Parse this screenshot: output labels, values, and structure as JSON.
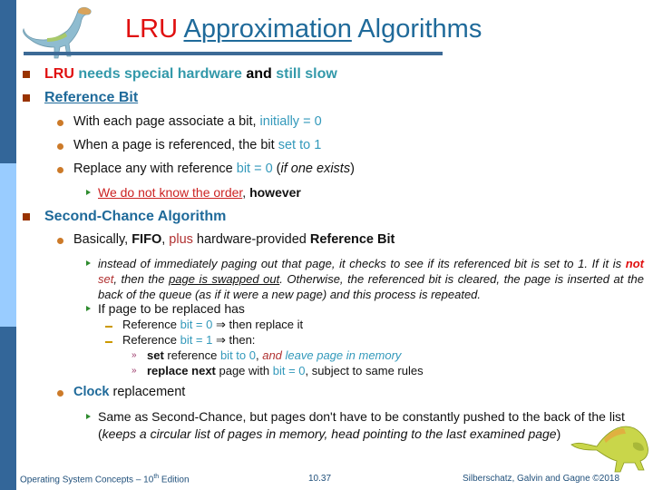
{
  "slide": {
    "title": {
      "part1": "LRU",
      "part2": "Approximation",
      "part3": "Algorithms"
    },
    "bullets": {
      "b1": {
        "lru": "LRU",
        "a": "needs special hardware",
        "and": "and",
        "b": "still slow"
      },
      "b2": {
        "label": "Reference Bit"
      },
      "b2_1": {
        "a": "With each page associate a bit, ",
        "b": "initially = 0"
      },
      "b2_2": {
        "a": "When a page is referenced, the bit ",
        "b": "set to 1"
      },
      "b2_3": {
        "a": "Replace any with reference ",
        "b": "bit = 0",
        "c": " (",
        "d": "if one exists",
        "e": ")"
      },
      "b2_3_1": {
        "a": "We do not know the order",
        "b": ", ",
        "c": "however"
      },
      "b3": {
        "label": "Second-Chance Algorithm"
      },
      "b3_1": {
        "a": "Basically, ",
        "b": "FIFO",
        "c": ", ",
        "d": "plus",
        "e": " hardware-provided ",
        "f": "Reference Bit"
      },
      "b3_1_1": {
        "a": "instead of immediately paging out that page, it checks to see if its referenced bit is set to 1. If it is ",
        "b": "not",
        "c": " set",
        "d": ", then the ",
        "e": "page is swapped out",
        "f": ". Otherwise, the referenced bit is cleared, the page is inserted at the back of the queue (as if it were a new page) and this process is repeated."
      },
      "b3_1_2": {
        "label": "If page to be replaced has"
      },
      "b3_1_2_1": {
        "a": "Reference ",
        "b": "bit = 0",
        "c": " ⇒ then replace it"
      },
      "b3_1_2_2": {
        "a": "Reference ",
        "b": "bit = 1",
        "c": " ⇒ then:"
      },
      "b3_1_2_2_1": {
        "a": "set",
        "b": " reference ",
        "c": "bit to 0",
        "d": ", ",
        "e": "and",
        "f": " leave page in memory"
      },
      "b3_1_2_2_2": {
        "a": "replace next",
        "b": " page with ",
        "c": "bit = 0",
        "d": ", subject to same rules"
      },
      "b3_2": {
        "a": "Clock",
        "b": " replacement"
      },
      "b3_2_1": {
        "a": "Same as Second-Chance, but pages don't have to be constantly pushed to the back of the list (",
        "b": "keeps a circular list of pages in memory, head pointing to the last examined page",
        "c": ")"
      }
    },
    "footer": {
      "left_a": "Operating System Concepts – 10",
      "left_sup": "th",
      "left_b": " Edition",
      "center": "10.37",
      "right": "Silberschatz, Galvin and Gagne ©2018"
    },
    "colors": {
      "sidebar_dark": "#336699",
      "sidebar_light": "#99ccff",
      "title_blue": "#1f6a9a",
      "accent_red": "#e01010",
      "accent_cyan": "#3399bb"
    }
  }
}
